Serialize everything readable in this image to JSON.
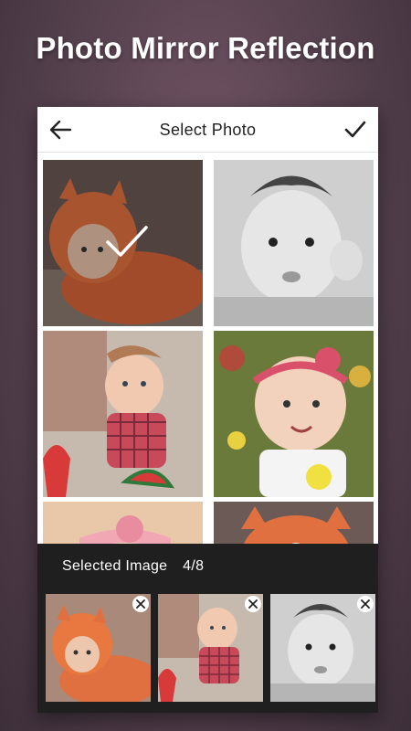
{
  "promo": {
    "title": "Photo Mirror Reflection"
  },
  "toolbar": {
    "title": "Select Photo",
    "back_icon": "arrow-left-icon",
    "done_icon": "checkmark-icon"
  },
  "grid": {
    "photos": [
      {
        "name": "baby-in-fox-costume",
        "selected": true
      },
      {
        "name": "baby-grayscale-portrait",
        "selected": false
      },
      {
        "name": "baby-with-watermelon",
        "selected": false
      },
      {
        "name": "baby-with-flower-headband",
        "selected": false
      },
      {
        "name": "baby-pink-bow",
        "selected": false
      },
      {
        "name": "baby-fox-hat",
        "selected": false
      }
    ]
  },
  "tray": {
    "label": "Selected Image",
    "count": "4/8",
    "thumbnails": [
      "baby-in-fox-costume",
      "baby-with-watermelon",
      "baby-grayscale-portrait"
    ],
    "remove_icon": "close-icon"
  },
  "colors": {
    "accent_background": "#5a4452",
    "tray": "#1f1f1f",
    "toolbar": "#ffffff"
  }
}
